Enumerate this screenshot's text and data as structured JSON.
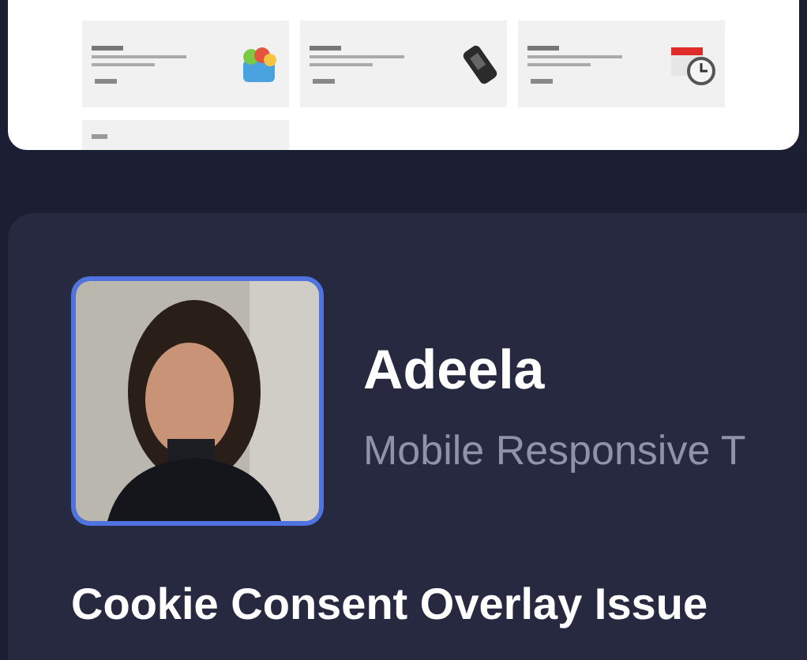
{
  "preview_cards": [
    {
      "kind": "basket"
    },
    {
      "kind": "phone"
    },
    {
      "kind": "calendar"
    },
    {
      "kind": "blank"
    }
  ],
  "profile": {
    "name": "Adeela",
    "subtitle": "Mobile Responsive T"
  },
  "headline": "Cookie Consent Overlay Issue"
}
